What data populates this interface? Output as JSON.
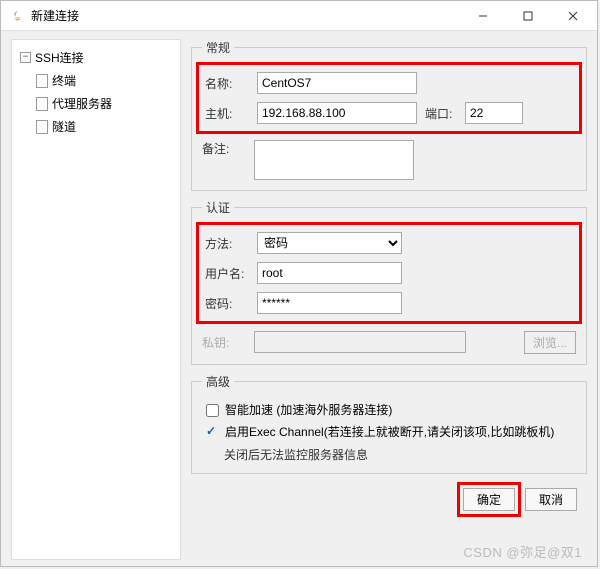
{
  "window": {
    "title": "新建连接"
  },
  "sidebar": {
    "root": "SSH连接",
    "children": [
      "终端",
      "代理服务器",
      "隧道"
    ]
  },
  "general": {
    "legend": "常规",
    "name_label": "名称:",
    "name_value": "CentOS7",
    "host_label": "主机:",
    "host_value": "192.168.88.100",
    "port_label": "端口:",
    "port_value": "22",
    "remark_label": "备注:",
    "remark_value": ""
  },
  "auth": {
    "legend": "认证",
    "method_label": "方法:",
    "method_value": "密码",
    "method_options": [
      "密码"
    ],
    "user_label": "用户名:",
    "user_value": "root",
    "pass_label": "密码:",
    "pass_value": "******",
    "key_label": "私钥:",
    "key_value": "",
    "browse_label": "浏览..."
  },
  "advanced": {
    "legend": "高级",
    "accel_checked": false,
    "accel_label": "智能加速 (加速海外服务器连接)",
    "exec_checked": true,
    "exec_label": "启用Exec Channel(若连接上就被断开,请关闭该项,比如跳板机)",
    "exec_sub": "关闭后无法监控服务器信息"
  },
  "footer": {
    "ok": "确定",
    "cancel": "取消"
  },
  "watermark": "CSDN @弥足@双1"
}
